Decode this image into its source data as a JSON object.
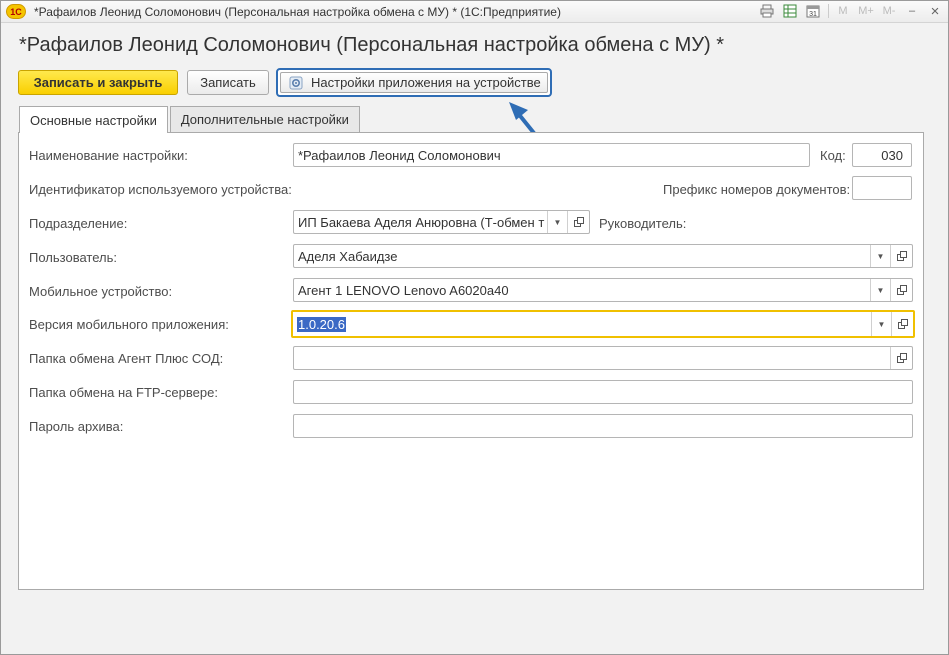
{
  "window": {
    "logo": "1С",
    "title": "*Рафаилов Леонид Соломонович (Персональная настройка обмена с МУ) *  (1С:Предприятие)",
    "toolbar_icons": [
      "print-icon",
      "table-icon",
      "calendar-icon"
    ],
    "toolbar_labels": {
      "m": "M",
      "m_plus": "M+",
      "m_minus": "M-",
      "minimize": "–",
      "close": "×"
    }
  },
  "form": {
    "title": "*Рафаилов Леонид Соломонович (Персональная настройка обмена с МУ) *"
  },
  "commands": {
    "save_close": "Записать и закрыть",
    "save": "Записать",
    "app_settings": "Настройки приложения на устройстве"
  },
  "tabs": [
    {
      "label": "Основные настройки",
      "active": true
    },
    {
      "label": "Дополнительные настройки",
      "active": false
    }
  ],
  "fields": {
    "name": {
      "label": "Наименование настройки:",
      "value": "*Рафаилов Леонид Соломонович"
    },
    "code": {
      "label": "Код:",
      "value": "030"
    },
    "device_id": {
      "label": "Идентификатор используемого устройства:"
    },
    "doc_prefix": {
      "label": "Префикс номеров документов:",
      "value": ""
    },
    "division": {
      "label": "Подразделение:",
      "value": "ИП Бакаева Аделя Анюровна  (Т-обмен т"
    },
    "manager": {
      "label": "Руководитель:"
    },
    "user": {
      "label": "Пользователь:",
      "value": "Аделя Хабаидзе"
    },
    "mobile_device": {
      "label": "Мобильное устройство:",
      "value": "Агент 1 LENOVO Lenovo A6020a40"
    },
    "app_version": {
      "label": "Версия мобильного приложения:",
      "value": "1.0.20.6"
    },
    "exchange_folder": {
      "label": "Папка обмена Агент Плюс СОД:",
      "value": ""
    },
    "ftp_folder": {
      "label": "Папка обмена на FTP-сервере:",
      "value": ""
    },
    "archive_password": {
      "label": "Пароль архива:",
      "value": ""
    }
  },
  "colors": {
    "primary_button": "#f9cf00",
    "highlight_frame": "#2f6db5",
    "active_field_border": "#f0c000",
    "selection": "#3b69c5"
  }
}
